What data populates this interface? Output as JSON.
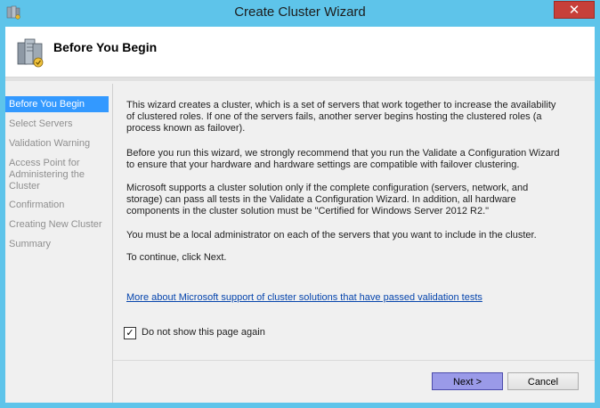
{
  "window": {
    "title": "Create Cluster Wizard",
    "close_label": "✕"
  },
  "header": {
    "title": "Before You Begin"
  },
  "sidebar": {
    "items": [
      {
        "label": "Before You Begin",
        "active": true
      },
      {
        "label": "Select Servers",
        "active": false
      },
      {
        "label": "Validation Warning",
        "active": false
      },
      {
        "label": "Access Point for Administering the Cluster",
        "active": false
      },
      {
        "label": "Confirmation",
        "active": false
      },
      {
        "label": "Creating New Cluster",
        "active": false
      },
      {
        "label": "Summary",
        "active": false
      }
    ]
  },
  "content": {
    "paragraphs": [
      "This wizard creates a cluster, which is a set of servers that work together to increase the availability of clustered roles. If one of the servers fails, another server begins hosting the clustered roles (a process known as failover).",
      "Before you run this wizard, we strongly recommend that you run the Validate a Configuration Wizard to ensure that your hardware and hardware settings are compatible with failover clustering.",
      "Microsoft supports a cluster solution only if the complete configuration (servers, network, and storage) can pass all tests in the Validate a Configuration Wizard. In addition, all hardware components in the cluster solution must be \"Certified for Windows Server 2012 R2.\"",
      "You must be a local administrator on each of the servers that you want to include in the cluster.",
      "To continue, click Next."
    ],
    "link_text": "More about Microsoft support of cluster solutions that have passed validation tests",
    "checkbox": {
      "label": "Do not show this page again",
      "checked": true,
      "mark": "✓"
    }
  },
  "buttons": {
    "next": "Next >",
    "cancel": "Cancel"
  },
  "colors": {
    "frame": "#5ec4ea",
    "selection": "#3399ff",
    "close": "#c7403a",
    "link": "#0645ad"
  }
}
